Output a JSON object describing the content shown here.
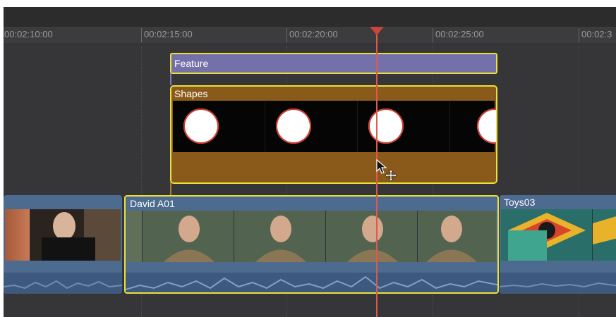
{
  "timeline": {
    "ruler": {
      "ticks": [
        "00:02:10:00",
        "00:02:15:00",
        "00:02:20:00",
        "00:02:25:00",
        "00:02:3"
      ]
    },
    "clips": {
      "feature": {
        "label": "Feature",
        "color": "#7470aa"
      },
      "shapes": {
        "label": "Shapes",
        "color": "#8a5a1a"
      },
      "david": {
        "label": "David A01",
        "color": "#4d6a8f"
      },
      "toys": {
        "label": "Toys03",
        "color": "#4d6a8f"
      }
    },
    "selection_color": "#e9e03c",
    "playhead": {
      "color": "#e0584e"
    }
  },
  "icons": {
    "cursor": "arrow-pointer-icon",
    "move": "move-arrows-icon"
  }
}
